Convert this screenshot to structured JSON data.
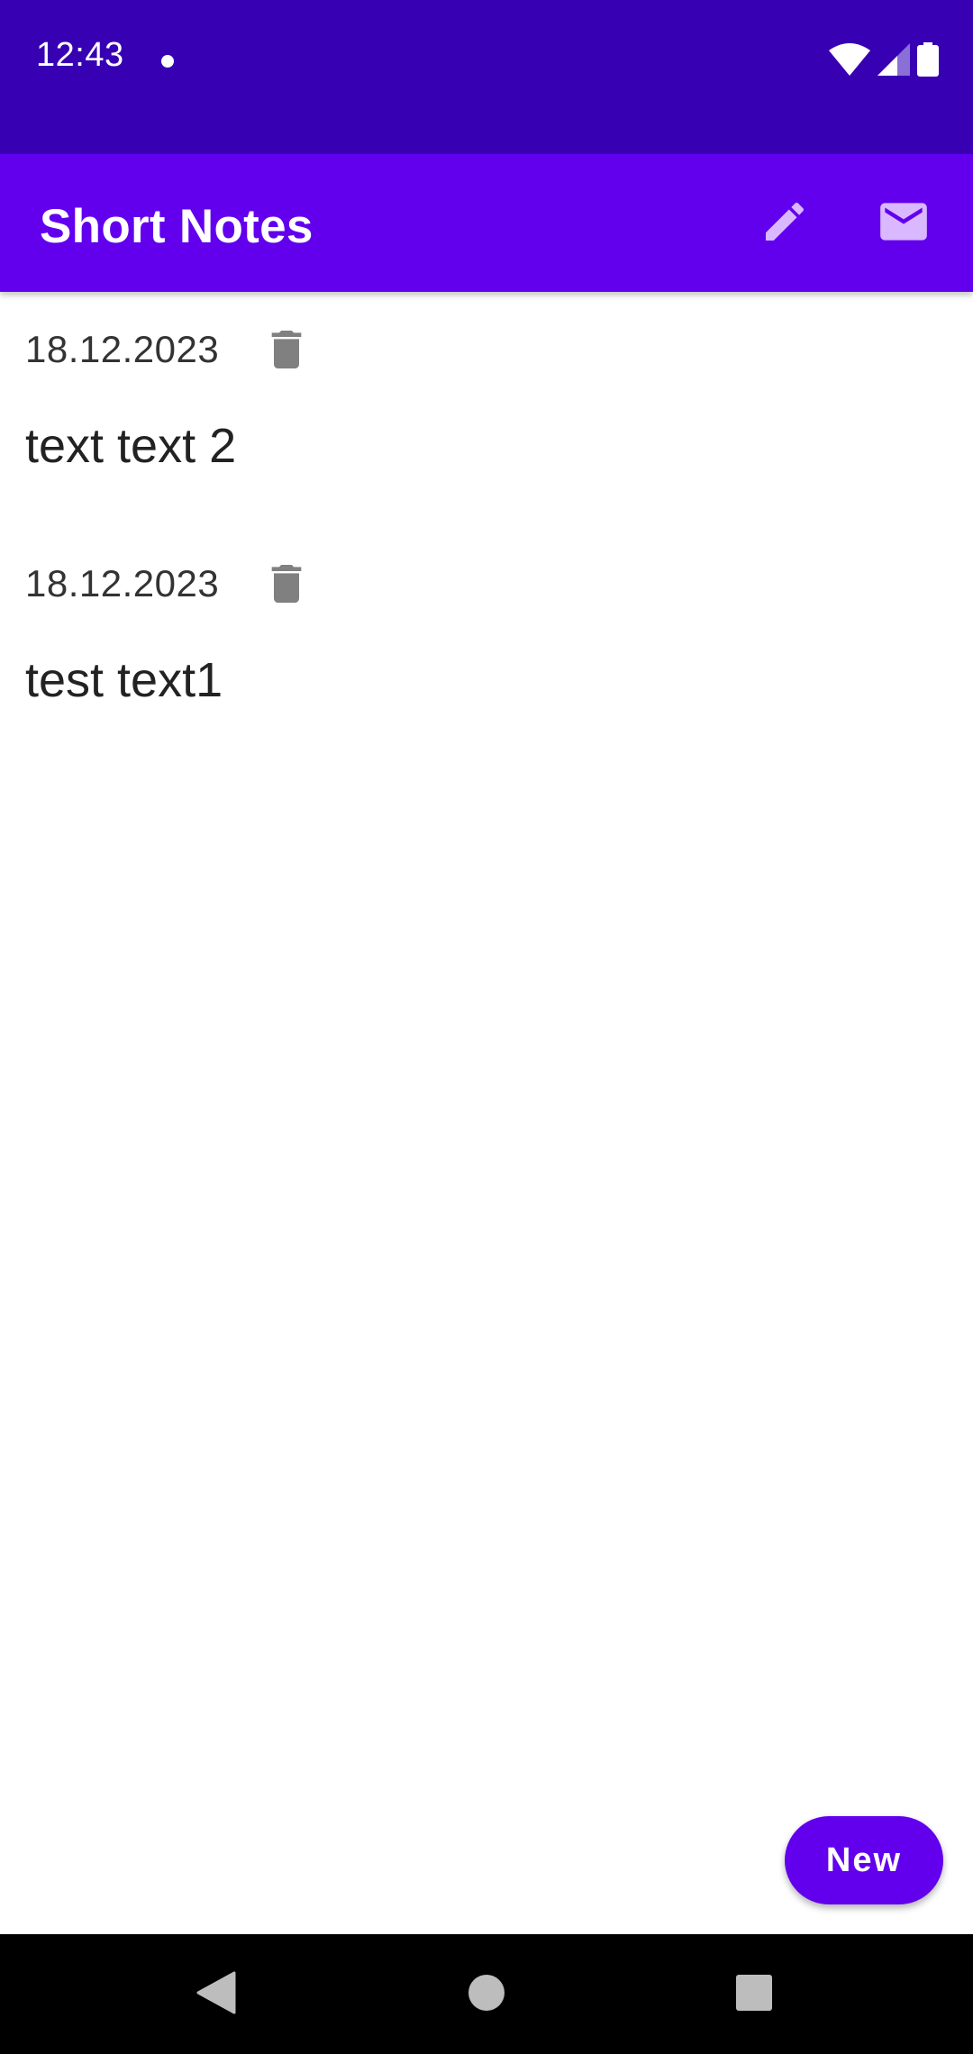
{
  "status_bar": {
    "time": "12:43",
    "icons": [
      "notification-dot-icon",
      "wifi-icon",
      "signal-icon",
      "battery-icon"
    ]
  },
  "app_bar": {
    "title": "Short Notes",
    "actions": [
      "edit-icon",
      "mail-icon"
    ]
  },
  "notes": [
    {
      "date": "18.12.2023",
      "text": "text text 2"
    },
    {
      "date": "18.12.2023",
      "text": "test text1"
    }
  ],
  "fab": {
    "label": "New"
  },
  "nav_bar": {
    "buttons": [
      "back",
      "home",
      "recents"
    ]
  },
  "colors": {
    "status_bar": "#3700b3",
    "primary": "#6200ee",
    "icon_tint": "#d9b8ff",
    "delete_icon": "#808080"
  }
}
